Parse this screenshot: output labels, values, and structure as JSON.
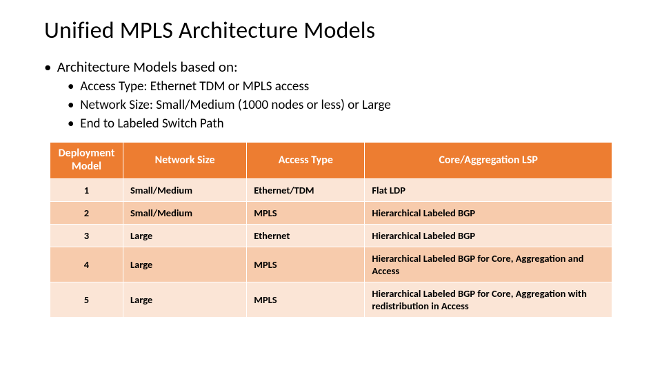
{
  "title": "Unified MPLS Architecture Models",
  "intro": "Architecture Models based on:",
  "sub": {
    "a": "Access Type: Ethernet TDM or MPLS access",
    "b": "Network Size: Small/Medium (1000 nodes or less) or Large",
    "c": "End to Labeled Switch Path"
  },
  "headers": {
    "h1": "Deployment Model",
    "h2": "Network Size",
    "h3": "Access Type",
    "h4": "Core/Aggregation LSP"
  },
  "rows": [
    {
      "model": "1",
      "size": "Small/Medium",
      "access": "Ethernet/TDM",
      "lsp": "Flat LDP"
    },
    {
      "model": "2",
      "size": "Small/Medium",
      "access": "MPLS",
      "lsp": "Hierarchical Labeled BGP"
    },
    {
      "model": "3",
      "size": "Large",
      "access": "Ethernet",
      "lsp": "Hierarchical Labeled BGP"
    },
    {
      "model": "4",
      "size": "Large",
      "access": "MPLS",
      "lsp": "Hierarchical Labeled BGP for Core, Aggregation and Access"
    },
    {
      "model": "5",
      "size": "Large",
      "access": "MPLS",
      "lsp": "Hierarchical Labeled BGP for Core, Aggregation with redistribution in Access"
    }
  ],
  "chart_data": {
    "type": "table",
    "columns": [
      "Deployment Model",
      "Network Size",
      "Access Type",
      "Core/Aggregation LSP"
    ],
    "rows": [
      [
        "1",
        "Small/Medium",
        "Ethernet/TDM",
        "Flat LDP"
      ],
      [
        "2",
        "Small/Medium",
        "MPLS",
        "Hierarchical Labeled BGP"
      ],
      [
        "3",
        "Large",
        "Ethernet",
        "Hierarchical Labeled BGP"
      ],
      [
        "4",
        "Large",
        "MPLS",
        "Hierarchical Labeled BGP for Core, Aggregation and Access"
      ],
      [
        "5",
        "Large",
        "MPLS",
        "Hierarchical Labeled BGP for Core, Aggregation with redistribution in Access"
      ]
    ]
  }
}
